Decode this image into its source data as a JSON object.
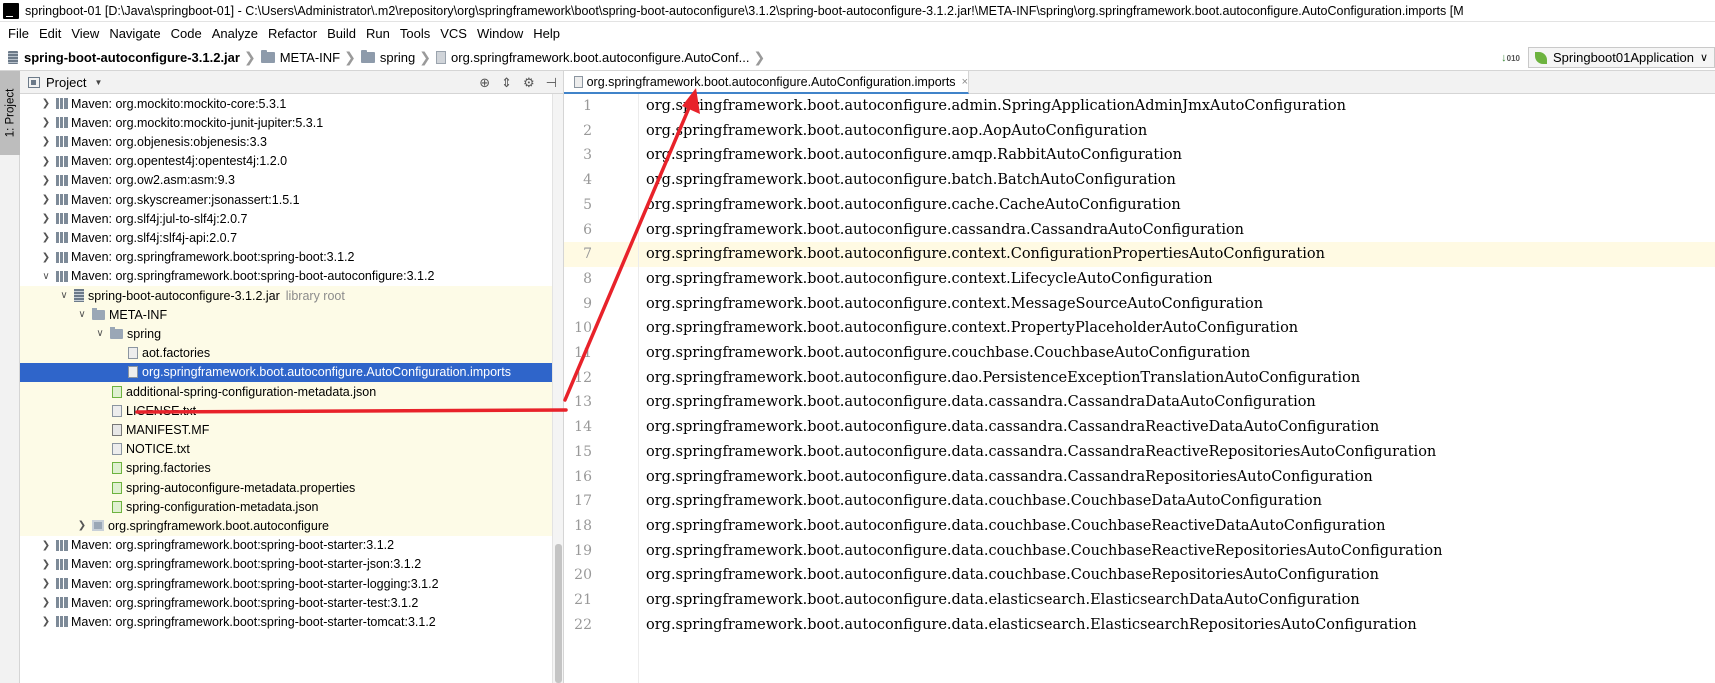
{
  "window": {
    "title": "springboot-01 [D:\\Java\\springboot-01] - C:\\Users\\Administrator\\.m2\\repository\\org\\springframework\\boot\\spring-boot-autoconfigure\\3.1.2\\spring-boot-autoconfigure-3.1.2.jar!\\META-INF\\spring\\org.springframework.boot.autoconfigure.AutoConfiguration.imports [M"
  },
  "menu": [
    "File",
    "Edit",
    "View",
    "Navigate",
    "Code",
    "Analyze",
    "Refactor",
    "Build",
    "Run",
    "Tools",
    "VCS",
    "Window",
    "Help"
  ],
  "breadcrumb": [
    "spring-boot-autoconfigure-3.1.2.jar",
    "META-INF",
    "spring",
    "org.springframework.boot.autoconfigure.AutoConf..."
  ],
  "run_config": {
    "label": "Springboot01Application",
    "caret": "∨"
  },
  "tool_window": {
    "strip_label": "1: Project",
    "title": "Project",
    "caret": "▼"
  },
  "tree": [
    {
      "label": "Maven: org.mockito:mockito-core:5.3.1"
    },
    {
      "label": "Maven: org.mockito:mockito-junit-jupiter:5.3.1"
    },
    {
      "label": "Maven: org.objenesis:objenesis:3.3"
    },
    {
      "label": "Maven: org.opentest4j:opentest4j:1.2.0"
    },
    {
      "label": "Maven: org.ow2.asm:asm:9.3"
    },
    {
      "label": "Maven: org.skyscreamer:jsonassert:1.5.1"
    },
    {
      "label": "Maven: org.slf4j:jul-to-slf4j:2.0.7"
    },
    {
      "label": "Maven: org.slf4j:slf4j-api:2.0.7"
    },
    {
      "label": "Maven: org.springframework.boot:spring-boot:3.1.2"
    },
    {
      "label": "Maven: org.springframework.boot:spring-boot-autoconfigure:3.1.2"
    },
    {
      "label": "spring-boot-autoconfigure-3.1.2.jar",
      "extra": "library root"
    },
    {
      "label": "META-INF"
    },
    {
      "label": "spring"
    },
    {
      "label": "aot.factories"
    },
    {
      "label": "org.springframework.boot.autoconfigure.AutoConfiguration.imports"
    },
    {
      "label": "additional-spring-configuration-metadata.json"
    },
    {
      "label": "LICENSE.txt"
    },
    {
      "label": "MANIFEST.MF"
    },
    {
      "label": "NOTICE.txt"
    },
    {
      "label": "spring.factories"
    },
    {
      "label": "spring-autoconfigure-metadata.properties"
    },
    {
      "label": "spring-configuration-metadata.json"
    },
    {
      "label": "org.springframework.boot.autoconfigure"
    },
    {
      "label": "Maven: org.springframework.boot:spring-boot-starter:3.1.2"
    },
    {
      "label": "Maven: org.springframework.boot:spring-boot-starter-json:3.1.2"
    },
    {
      "label": "Maven: org.springframework.boot:spring-boot-starter-logging:3.1.2"
    },
    {
      "label": "Maven: org.springframework.boot:spring-boot-starter-test:3.1.2"
    },
    {
      "label": "Maven: org.springframework.boot:spring-boot-starter-tomcat:3.1.2"
    }
  ],
  "editor": {
    "tab_label": "org.springframework.boot.autoconfigure.AutoConfiguration.imports",
    "tab_close": "×",
    "current_line": 7,
    "lines": [
      "org.springframework.boot.autoconfigure.admin.SpringApplicationAdminJmxAutoConfiguration",
      "org.springframework.boot.autoconfigure.aop.AopAutoConfiguration",
      "org.springframework.boot.autoconfigure.amqp.RabbitAutoConfiguration",
      "org.springframework.boot.autoconfigure.batch.BatchAutoConfiguration",
      "org.springframework.boot.autoconfigure.cache.CacheAutoConfiguration",
      "org.springframework.boot.autoconfigure.cassandra.CassandraAutoConfiguration",
      "org.springframework.boot.autoconfigure.context.ConfigurationPropertiesAutoConfiguration",
      "org.springframework.boot.autoconfigure.context.LifecycleAutoConfiguration",
      "org.springframework.boot.autoconfigure.context.MessageSourceAutoConfiguration",
      "org.springframework.boot.autoconfigure.context.PropertyPlaceholderAutoConfiguration",
      "org.springframework.boot.autoconfigure.couchbase.CouchbaseAutoConfiguration",
      "org.springframework.boot.autoconfigure.dao.PersistenceExceptionTranslationAutoConfiguration",
      "org.springframework.boot.autoconfigure.data.cassandra.CassandraDataAutoConfiguration",
      "org.springframework.boot.autoconfigure.data.cassandra.CassandraReactiveDataAutoConfiguration",
      "org.springframework.boot.autoconfigure.data.cassandra.CassandraReactiveRepositoriesAutoConfiguration",
      "org.springframework.boot.autoconfigure.data.cassandra.CassandraRepositoriesAutoConfiguration",
      "org.springframework.boot.autoconfigure.data.couchbase.CouchbaseDataAutoConfiguration",
      "org.springframework.boot.autoconfigure.data.couchbase.CouchbaseReactiveDataAutoConfiguration",
      "org.springframework.boot.autoconfigure.data.couchbase.CouchbaseReactiveRepositoriesAutoConfiguration",
      "org.springframework.boot.autoconfigure.data.couchbase.CouchbaseRepositoriesAutoConfiguration",
      "org.springframework.boot.autoconfigure.data.elasticsearch.ElasticsearchDataAutoConfiguration",
      "org.springframework.boot.autoconfigure.data.elasticsearch.ElasticsearchRepositoriesAutoConfiguration"
    ]
  },
  "colors": {
    "selection": "#2f65ca",
    "library_root_bg": "#fdfbe7",
    "current_line_bg": "#fffae3",
    "annotation": "#e8222a"
  }
}
